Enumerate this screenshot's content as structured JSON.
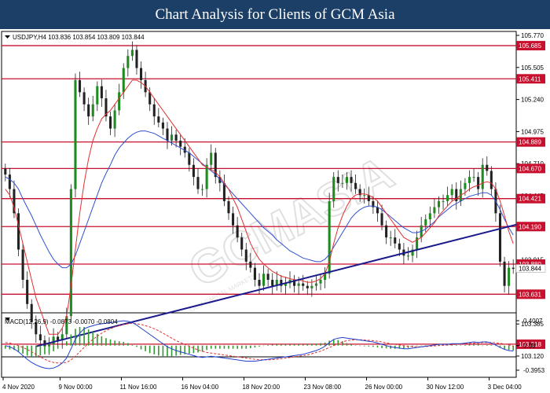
{
  "header": {
    "title": "Chart Analysis for Clients of GCM Asia"
  },
  "colors": {
    "title_bg": "#1b3f66",
    "level_line": "#c8102e",
    "level_label_bg": "#c8102e",
    "trendline": "#1a1a8c",
    "ma_fast": "#e03030",
    "ma_slow": "#3050d0",
    "bull": "#1f8a1f",
    "bear": "#222222",
    "macd_line": "#2040d0",
    "signal_line": "#e03030",
    "histogram": "#2f9a2f"
  },
  "watermark": {
    "text": "GCMASIA",
    "sub": "GCM CAPITAL MARKETS"
  },
  "chart_data": [
    {
      "type": "candlestick",
      "title": "",
      "label": "USDJPY,H4  103.836 103.854 103.809 103.844",
      "ohlc": {
        "open": 103.836,
        "high": 103.854,
        "low": 103.809,
        "close": 103.844
      },
      "ylim": [
        103.12,
        105.77
      ],
      "yticks": [
        105.77,
        105.505,
        105.24,
        104.975,
        104.71,
        104.445,
        104.18,
        103.915,
        103.65,
        103.385,
        103.12
      ],
      "ytick_labels": [
        "105.770",
        "105.505",
        "105.240",
        "104.975",
        "104.710",
        "104.445",
        "104.180",
        "103.915",
        "103.650",
        "103.385",
        "103.120"
      ],
      "current_price": "103.844",
      "levels": [
        {
          "value": 105.685,
          "label": "105.685"
        },
        {
          "value": 105.411,
          "label": "105.411"
        },
        {
          "value": 104.889,
          "label": "104.889"
        },
        {
          "value": 104.67,
          "label": "104.670"
        },
        {
          "value": 104.421,
          "label": "104.421"
        },
        {
          "value": 104.19,
          "label": "104.190"
        },
        {
          "value": 103.88,
          "label": "103.880"
        },
        {
          "value": 103.631,
          "label": "103.631"
        },
        {
          "value": 103.218,
          "label": "103.218"
        }
      ],
      "xtick_labels": [
        "4 Nov 2020",
        "9 Nov 00:00",
        "11 Nov 16:00",
        "16 Nov 04:00",
        "18 Nov 20:00",
        "23 Nov 08:00",
        "26 Nov 00:00",
        "30 Nov 12:00",
        "3 Dec 04:00"
      ],
      "xtick_index": [
        0,
        13,
        27,
        41,
        55,
        69,
        83,
        97,
        111
      ],
      "trendline": {
        "from": {
          "index": 7,
          "value": 103.2
        },
        "to": {
          "index": 140,
          "value": 104.42
        }
      },
      "closes": [
        104.62,
        104.5,
        104.3,
        104.0,
        103.75,
        103.55,
        103.4,
        103.3,
        103.25,
        103.2,
        103.22,
        103.28,
        103.25,
        103.3,
        103.45,
        104.5,
        105.4,
        105.3,
        105.2,
        105.1,
        105.2,
        105.35,
        105.25,
        105.1,
        105.0,
        105.15,
        105.3,
        105.5,
        105.6,
        105.65,
        105.5,
        105.4,
        105.3,
        105.2,
        105.1,
        105.05,
        105.0,
        104.9,
        104.95,
        104.9,
        104.85,
        104.8,
        104.7,
        104.6,
        104.5,
        104.5,
        104.7,
        104.8,
        104.6,
        104.55,
        104.4,
        104.3,
        104.2,
        104.1,
        104.0,
        103.9,
        103.85,
        103.75,
        103.7,
        103.8,
        103.75,
        103.7,
        103.75,
        103.7,
        103.72,
        103.75,
        103.7,
        103.72,
        103.7,
        103.68,
        103.7,
        103.72,
        103.75,
        103.8,
        104.4,
        104.6,
        104.55,
        104.55,
        104.6,
        104.55,
        104.5,
        104.45,
        104.45,
        104.4,
        104.35,
        104.3,
        104.2,
        104.1,
        104.1,
        104.05,
        104.0,
        103.95,
        103.95,
        104.0,
        104.1,
        104.2,
        104.25,
        104.3,
        104.35,
        104.4,
        104.4,
        104.45,
        104.5,
        104.4,
        104.5,
        104.55,
        104.6,
        104.6,
        104.5,
        104.7,
        104.65,
        104.5,
        104.3,
        103.9,
        103.7,
        103.85,
        103.84
      ],
      "ma_fast": [
        104.5,
        104.45,
        104.35,
        104.2,
        104.05,
        103.9,
        103.75,
        103.6,
        103.5,
        103.4,
        103.3,
        103.3,
        103.3,
        103.35,
        103.45,
        103.7,
        104.0,
        104.3,
        104.55,
        104.75,
        104.9,
        105.0,
        105.08,
        105.12,
        105.15,
        105.2,
        105.25,
        105.3,
        105.35,
        105.4,
        105.4,
        105.38,
        105.35,
        105.3,
        105.25,
        105.2,
        105.15,
        105.1,
        105.05,
        105.0,
        104.95,
        104.9,
        104.85,
        104.8,
        104.75,
        104.7,
        104.68,
        104.66,
        104.64,
        104.6,
        104.55,
        104.5,
        104.42,
        104.35,
        104.25,
        104.15,
        104.05,
        103.98,
        103.92,
        103.88,
        103.85,
        103.82,
        103.8,
        103.78,
        103.77,
        103.76,
        103.75,
        103.75,
        103.74,
        103.73,
        103.73,
        103.74,
        103.76,
        103.8,
        103.9,
        104.05,
        104.18,
        104.28,
        104.36,
        104.42,
        104.45,
        104.46,
        104.46,
        104.45,
        104.43,
        104.4,
        104.35,
        104.3,
        104.25,
        104.2,
        104.15,
        104.1,
        104.08,
        104.06,
        104.08,
        104.1,
        104.14,
        104.18,
        104.22,
        104.28,
        104.32,
        104.36,
        104.4,
        104.42,
        104.45,
        104.47,
        104.5,
        104.52,
        104.53,
        104.55,
        104.56,
        104.55,
        104.5,
        104.4,
        104.28,
        104.15,
        104.05
      ],
      "ma_slow": [
        104.6,
        104.58,
        104.55,
        104.5,
        104.42,
        104.35,
        104.28,
        104.2,
        104.12,
        104.05,
        103.98,
        103.92,
        103.88,
        103.85,
        103.85,
        103.88,
        103.95,
        104.05,
        104.15,
        104.25,
        104.35,
        104.45,
        104.55,
        104.63,
        104.7,
        104.78,
        104.84,
        104.88,
        104.92,
        104.95,
        104.97,
        104.98,
        104.98,
        104.97,
        104.96,
        104.94,
        104.92,
        104.9,
        104.88,
        104.86,
        104.84,
        104.82,
        104.8,
        104.77,
        104.74,
        104.71,
        104.68,
        104.65,
        104.62,
        104.58,
        104.54,
        104.5,
        104.46,
        104.42,
        104.38,
        104.34,
        104.3,
        104.26,
        104.22,
        104.18,
        104.15,
        104.12,
        104.08,
        104.05,
        104.02,
        103.99,
        103.97,
        103.95,
        103.93,
        103.92,
        103.91,
        103.9,
        103.9,
        103.92,
        103.96,
        104.02,
        104.08,
        104.14,
        104.2,
        104.26,
        104.3,
        104.33,
        104.35,
        104.36,
        104.36,
        104.35,
        104.33,
        104.3,
        104.27,
        104.24,
        104.21,
        104.18,
        104.16,
        104.14,
        104.14,
        104.15,
        104.17,
        104.2,
        104.23,
        104.27,
        104.3,
        104.33,
        104.36,
        104.38,
        104.4,
        104.42,
        104.44,
        104.45,
        104.46,
        104.47,
        104.47,
        104.45,
        104.4,
        104.33,
        104.25,
        104.18,
        104.12
      ]
    },
    {
      "type": "line",
      "title": "",
      "label": "MACD(12,26,9) -0.0873 -0.0070 -0.0804",
      "values": {
        "macd": -0.0873,
        "signal": -0.007,
        "histogram": -0.0804
      },
      "ylim": [
        -0.3953,
        0.4007
      ],
      "yticks": [
        0.4007,
        0.0,
        -0.3953
      ],
      "ytick_labels": [
        "0.4007",
        "0.00",
        "-0.3953"
      ],
      "series": [
        {
          "name": "MACD",
          "values": [
            0.0,
            -0.02,
            -0.05,
            -0.1,
            -0.16,
            -0.22,
            -0.27,
            -0.31,
            -0.34,
            -0.36,
            -0.37,
            -0.36,
            -0.33,
            -0.28,
            -0.2,
            -0.05,
            0.1,
            0.2,
            0.27,
            0.3,
            0.32,
            0.34,
            0.35,
            0.36,
            0.37,
            0.38,
            0.39,
            0.4,
            0.39,
            0.37,
            0.33,
            0.28,
            0.23,
            0.18,
            0.13,
            0.08,
            0.03,
            -0.02,
            -0.05,
            -0.08,
            -0.1,
            -0.12,
            -0.14,
            -0.16,
            -0.18,
            -0.19,
            -0.18,
            -0.17,
            -0.18,
            -0.19,
            -0.2,
            -0.21,
            -0.22,
            -0.23,
            -0.24,
            -0.25,
            -0.25,
            -0.25,
            -0.24,
            -0.23,
            -0.22,
            -0.21,
            -0.2,
            -0.19,
            -0.18,
            -0.17,
            -0.16,
            -0.15,
            -0.14,
            -0.12,
            -0.1,
            -0.08,
            -0.05,
            -0.01,
            0.05,
            0.1,
            0.12,
            0.13,
            0.12,
            0.11,
            0.1,
            0.09,
            0.08,
            0.07,
            0.06,
            0.04,
            0.02,
            0.0,
            -0.02,
            -0.03,
            -0.04,
            -0.05,
            -0.05,
            -0.04,
            -0.03,
            -0.02,
            -0.01,
            0.0,
            0.01,
            0.02,
            0.02,
            0.02,
            0.03,
            0.03,
            0.03,
            0.04,
            0.05,
            0.06,
            0.05,
            0.06,
            0.06,
            0.04,
            0.01,
            -0.03,
            -0.06,
            -0.08,
            -0.087
          ]
        },
        {
          "name": "Signal",
          "values": [
            0.05,
            0.04,
            0.02,
            0.0,
            -0.03,
            -0.06,
            -0.1,
            -0.14,
            -0.18,
            -0.22,
            -0.25,
            -0.27,
            -0.28,
            -0.28,
            -0.27,
            -0.23,
            -0.17,
            -0.1,
            -0.03,
            0.04,
            0.1,
            0.15,
            0.2,
            0.24,
            0.27,
            0.3,
            0.32,
            0.34,
            0.35,
            0.36,
            0.35,
            0.34,
            0.32,
            0.3,
            0.27,
            0.24,
            0.2,
            0.16,
            0.12,
            0.08,
            0.05,
            0.02,
            -0.01,
            -0.04,
            -0.07,
            -0.09,
            -0.11,
            -0.12,
            -0.13,
            -0.14,
            -0.15,
            -0.16,
            -0.17,
            -0.18,
            -0.19,
            -0.2,
            -0.21,
            -0.22,
            -0.225,
            -0.23,
            -0.23,
            -0.225,
            -0.22,
            -0.21,
            -0.2,
            -0.19,
            -0.18,
            -0.17,
            -0.16,
            -0.15,
            -0.13,
            -0.11,
            -0.09,
            -0.06,
            -0.03,
            0.0,
            0.03,
            0.06,
            0.08,
            0.09,
            0.095,
            0.095,
            0.09,
            0.085,
            0.08,
            0.07,
            0.06,
            0.045,
            0.03,
            0.02,
            0.01,
            0.0,
            -0.01,
            -0.015,
            -0.02,
            -0.02,
            -0.015,
            -0.01,
            -0.005,
            0.0,
            0.005,
            0.01,
            0.015,
            0.02,
            0.025,
            0.03,
            0.035,
            0.04,
            0.045,
            0.05,
            0.05,
            0.05,
            0.045,
            0.035,
            0.025,
            0.01,
            -0.007
          ]
        }
      ],
      "histogram": [
        -0.05,
        -0.06,
        -0.07,
        -0.1,
        -0.13,
        -0.16,
        -0.17,
        -0.17,
        -0.16,
        -0.14,
        -0.12,
        -0.09,
        -0.05,
        0.0,
        0.07,
        0.18,
        0.27,
        0.3,
        0.3,
        0.26,
        0.22,
        0.19,
        0.15,
        0.12,
        0.1,
        0.08,
        0.07,
        0.06,
        0.04,
        0.01,
        -0.02,
        -0.06,
        -0.09,
        -0.12,
        -0.14,
        -0.16,
        -0.17,
        -0.18,
        -0.17,
        -0.16,
        -0.15,
        -0.14,
        -0.13,
        -0.12,
        -0.11,
        -0.1,
        -0.07,
        -0.05,
        -0.05,
        -0.05,
        -0.05,
        -0.05,
        -0.05,
        -0.05,
        -0.05,
        -0.05,
        -0.04,
        -0.03,
        -0.015,
        0.0,
        0.01,
        0.015,
        0.02,
        0.02,
        0.02,
        0.02,
        0.02,
        0.02,
        0.02,
        0.03,
        0.03,
        0.03,
        0.04,
        0.05,
        0.08,
        0.1,
        0.09,
        0.07,
        0.04,
        0.02,
        0.005,
        -0.005,
        -0.01,
        -0.015,
        -0.02,
        -0.03,
        -0.04,
        -0.045,
        -0.05,
        -0.05,
        -0.05,
        -0.05,
        -0.04,
        -0.025,
        -0.01,
        0.0,
        0.005,
        0.005,
        0.01,
        0.02,
        0.015,
        0.01,
        0.015,
        0.01,
        0.005,
        0.01,
        0.015,
        0.02,
        0.015,
        0.0,
        0.01,
        0.01,
        -0.005,
        -0.025,
        -0.055,
        -0.07,
        -0.08
      ]
    }
  ]
}
